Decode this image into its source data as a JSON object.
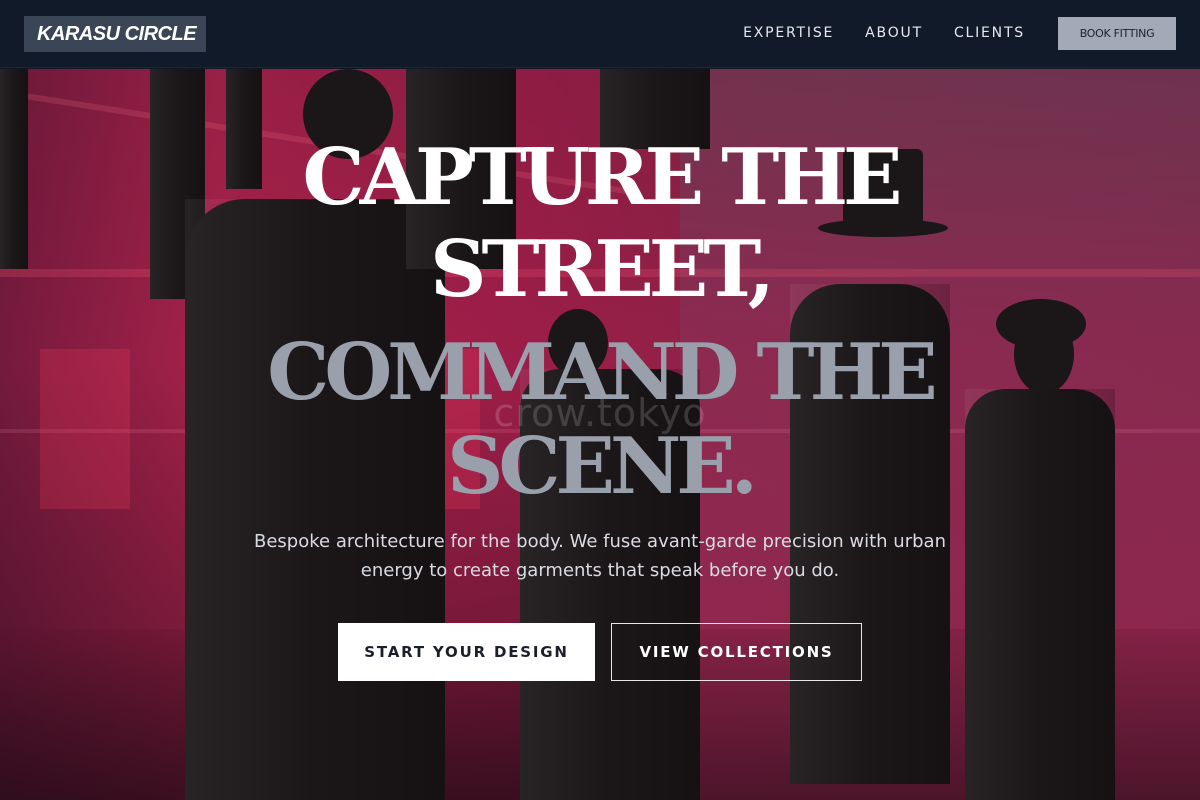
{
  "brand": {
    "logo_text": "KARASU CIRCLE"
  },
  "nav": {
    "items": [
      {
        "label": "EXPERTISE"
      },
      {
        "label": "ABOUT"
      },
      {
        "label": "CLIENTS"
      }
    ],
    "cta_label": "BOOK FITTING"
  },
  "hero": {
    "headline_line1": "CAPTURE THE",
    "headline_line2": "STREET,",
    "headline_line3": "COMMAND THE",
    "headline_line4": "SCENE.",
    "watermark": "crow.tokyo",
    "subtitle": "Bespoke architecture for the body. We fuse avant-garde precision with urban energy to create garments that speak before you do.",
    "primary_button": "START YOUR DESIGN",
    "secondary_button": "VIEW COLLECTIONS"
  },
  "colors": {
    "header_bg": "#111a28",
    "logo_bg": "#3a4556",
    "cta_bg": "#a3a9b6",
    "hero_magenta": "#b0234e",
    "headline_white": "#ffffff",
    "headline_gray": "#9aa0ab"
  }
}
